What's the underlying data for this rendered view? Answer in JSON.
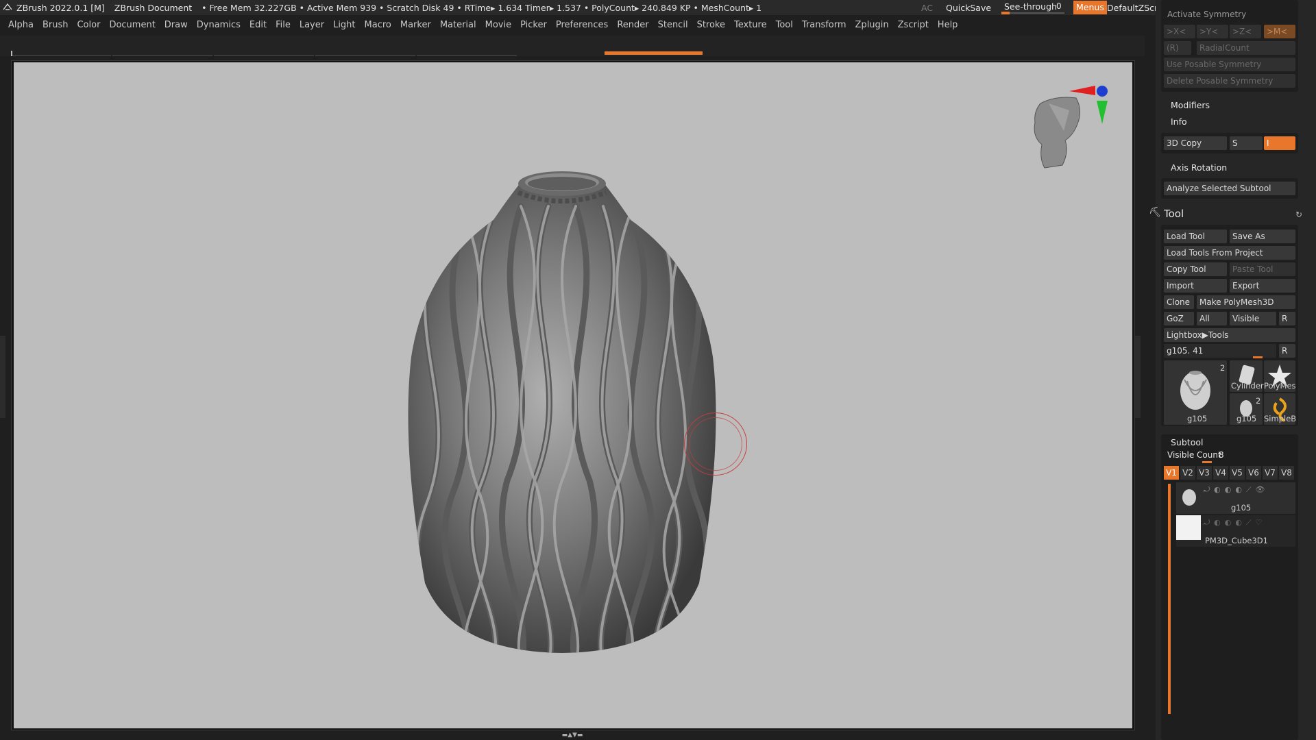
{
  "titlebar": {
    "app": "ZBrush 2022.0.1 [M]",
    "document": "ZBrush Document",
    "status": "• Free Mem 32.227GB • Active Mem 939 • Scratch Disk 49 •  RTime▸ 1.634 Timer▸ 1.537 • PolyCount▸ 240.849 KP  • MeshCount▸ 1",
    "ac": "AC",
    "quicksave": "QuickSave",
    "seethrough_label": "See-through",
    "seethrough_value": "0",
    "menus": "Menus",
    "default_script": "DefaultZScript"
  },
  "menubar": [
    "Alpha",
    "Brush",
    "Color",
    "Document",
    "Draw",
    "Dynamics",
    "Edit",
    "File",
    "Layer",
    "Light",
    "Macro",
    "Marker",
    "Material",
    "Movie",
    "Picker",
    "Preferences",
    "Render",
    "Stencil",
    "Stroke",
    "Texture",
    "Tool",
    "Transform",
    "Zplugin",
    "Zscript",
    "Help"
  ],
  "panel": {
    "activate_symmetry": "Activate Symmetry",
    "sym_x": ">X<",
    "sym_y": ">Y<",
    "sym_z": ">Z<",
    "sym_m": ">M<",
    "sym_r": "(R)",
    "radial_count": "RadialCount",
    "use_posable": "Use Posable Symmetry",
    "delete_posable": "Delete Posable Symmetry",
    "modifiers": "Modifiers",
    "info": "Info",
    "copy3d": "3D Copy",
    "s_label": "S",
    "axis_rotation": "Axis Rotation",
    "analyze_subtool": "Analyze Selected Subtool",
    "tool_title": "Tool",
    "load_tool": "Load Tool",
    "save_as": "Save As",
    "load_from_project": "Load Tools From Project",
    "copy_tool": "Copy Tool",
    "paste_tool": "Paste Tool",
    "import": "Import",
    "export": "Export",
    "clone": "Clone",
    "make_polymesh": "Make PolyMesh3D",
    "goz": "GoZ",
    "all": "All",
    "visible": "Visible",
    "r": "R",
    "lightbox_tools": "Lightbox▶Tools",
    "current_tool": "g105. 41",
    "thumbs": [
      {
        "caption": "g105",
        "count": "2"
      },
      {
        "caption": "Cylinder",
        "count": ""
      },
      {
        "caption": "PolyMes",
        "count": ""
      },
      {
        "caption": "g105",
        "count": "2"
      },
      {
        "caption": "SimpleB",
        "count": ""
      }
    ],
    "subtool_title": "Subtool",
    "visible_count_label": "Visible Count",
    "visible_count": "8",
    "vtabs": [
      "V1",
      "V2",
      "V3",
      "V4",
      "V5",
      "V6",
      "V7",
      "V8"
    ],
    "subtools": [
      "g105",
      "PM3D_Cube3D1"
    ]
  }
}
